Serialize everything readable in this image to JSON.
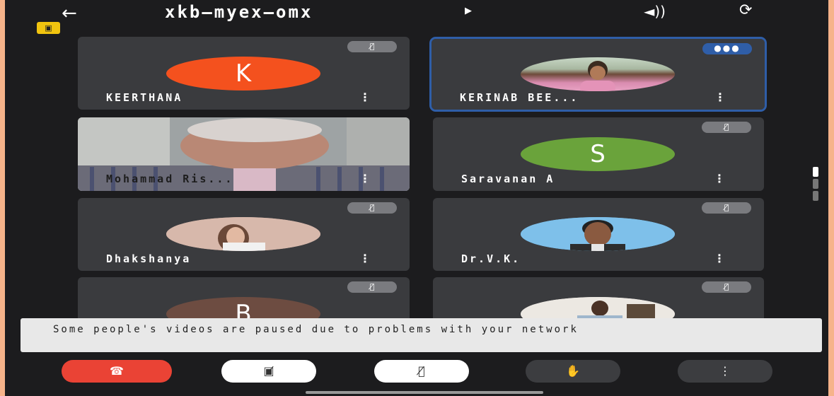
{
  "meeting": {
    "title": "xkb—myex—omx",
    "back_icon": "arrow-left-icon",
    "speaker_icon": "speaker-icon",
    "camera_flip_icon": "camera-flip-icon",
    "recording_badge_icon": "video-off-icon"
  },
  "participants": [
    {
      "name": "KEERTHANA",
      "avatar_letter": "K",
      "avatar_color": "#f4511e",
      "muted": true,
      "speaking": false
    },
    {
      "name": "KERINAB BEE...",
      "avatar_type": "photo",
      "muted": false,
      "speaking": true
    },
    {
      "name": "Mohammad Ris...",
      "avatar_type": "video",
      "muted": false,
      "speaking": false
    },
    {
      "name": "Saravanan A",
      "avatar_letter": "S",
      "avatar_color": "#6aa33b",
      "muted": true,
      "speaking": false
    },
    {
      "name": "Dhakshanya",
      "avatar_type": "photo",
      "muted": true,
      "speaking": false
    },
    {
      "name": "Dr.V.K.",
      "avatar_type": "photo",
      "muted": true,
      "speaking": false
    },
    {
      "name": "",
      "avatar_letter": "B",
      "avatar_color": "#6d4c41",
      "muted": true,
      "speaking": false
    },
    {
      "name": "",
      "avatar_type": "photo",
      "muted": true,
      "speaking": false
    }
  ],
  "toast": {
    "message": "Some people's videos are paused due to problems with your network"
  },
  "controls": {
    "end_call_color": "#ea4335",
    "end_call_icon": "phone-hangup-icon",
    "camera_icon": "camera-off-icon",
    "mic_icon": "mic-off-icon",
    "raise_hand_icon": "hand-icon",
    "more_icon": "more-vert-icon"
  }
}
